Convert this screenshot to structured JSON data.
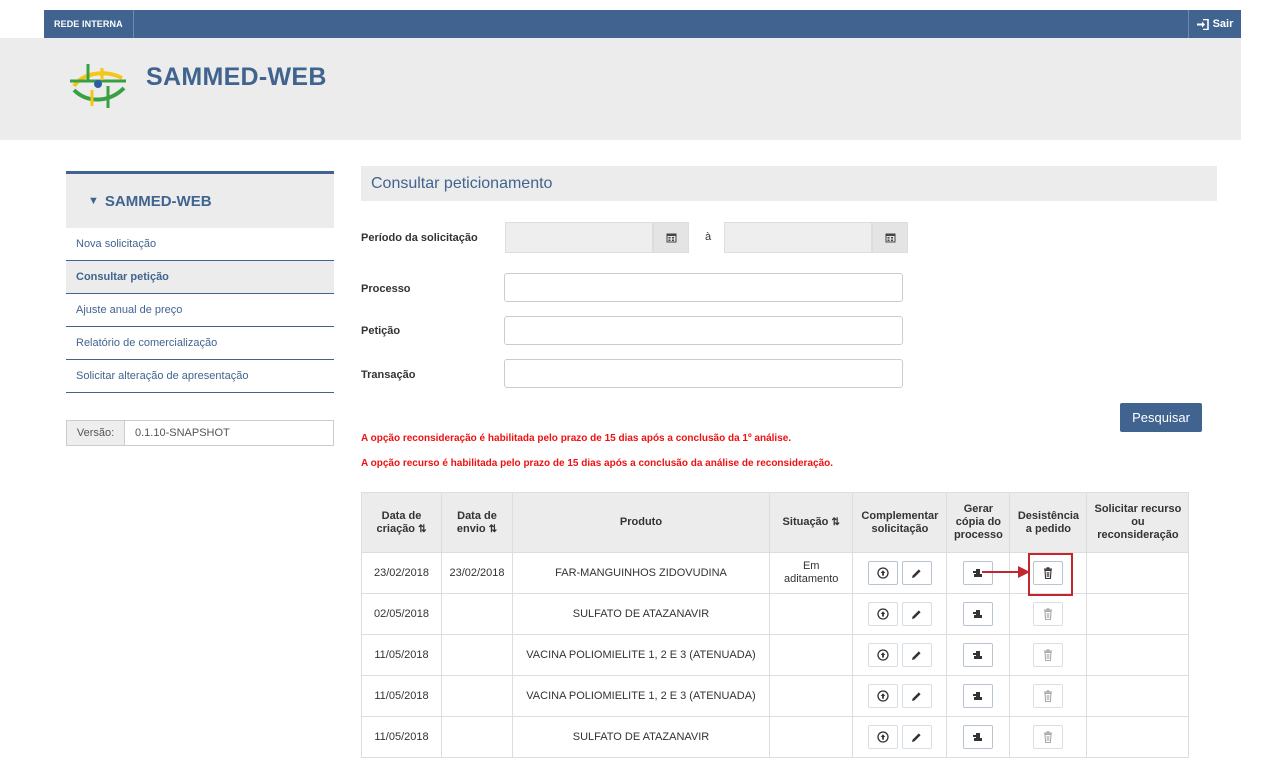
{
  "topbar": {
    "network_label": "REDE INTERNA",
    "logout_label": "Sair"
  },
  "app": {
    "title": "SAMMED-WEB"
  },
  "sidebar": {
    "header": "SAMMED-WEB",
    "items": [
      {
        "label": "Nova solicitação",
        "active": false
      },
      {
        "label": "Consultar petição",
        "active": true
      },
      {
        "label": "Ajuste anual de preço",
        "active": false
      },
      {
        "label": "Relatório de comercialização",
        "active": false
      },
      {
        "label": "Solicitar alteração de apresentação",
        "active": false
      }
    ],
    "version_label": "Versão:",
    "version_value": "0.1.10-SNAPSHOT"
  },
  "main": {
    "title": "Consultar peticionamento",
    "form": {
      "period_label": "Período da solicitação",
      "period_separator": "à",
      "process_label": "Processo",
      "petition_label": "Petição",
      "transaction_label": "Transação",
      "search_button": "Pesquisar"
    },
    "notices": [
      "A opção reconsideração é habilitada pelo prazo de 15 dias após a conclusão da 1º análise.",
      "A opção recurso é habilitada pelo prazo de 15 dias após a conclusão da análise de reconsideração."
    ],
    "table": {
      "headers": {
        "created": "Data de criação",
        "sent": "Data de envio",
        "product": "Produto",
        "status": "Situação",
        "complement": "Complementar solicitação",
        "copy": "Gerar cópia do processo",
        "withdraw": "Desistência a pedido",
        "appeal": "Solicitar recurso ou reconsideração"
      },
      "rows": [
        {
          "created": "23/02/2018",
          "sent": "23/02/2018",
          "product": "FAR-MANGUINHOS ZIDOVUDINA",
          "status": "Em aditamento"
        },
        {
          "created": "02/05/2018",
          "sent": "",
          "product": "SULFATO DE ATAZANAVIR",
          "status": ""
        },
        {
          "created": "11/05/2018",
          "sent": "",
          "product": "VACINA POLIOMIELITE 1, 2 E 3 (ATENUADA)",
          "status": ""
        },
        {
          "created": "11/05/2018",
          "sent": "",
          "product": "VACINA POLIOMIELITE 1, 2 E 3 (ATENUADA)",
          "status": ""
        },
        {
          "created": "11/05/2018",
          "sent": "",
          "product": "SULFATO DE ATAZANAVIR",
          "status": ""
        }
      ]
    }
  },
  "colors": {
    "primary": "#40648f",
    "notice": "#ee1111",
    "highlight": "#c1272d",
    "panel": "#ececec"
  }
}
